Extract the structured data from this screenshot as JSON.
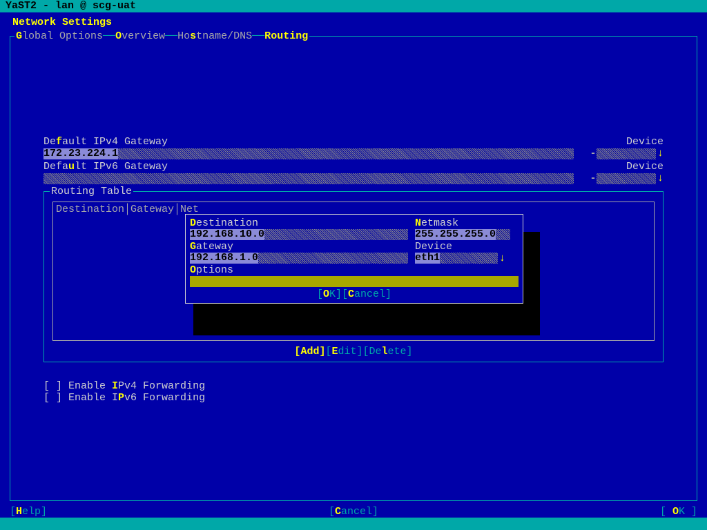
{
  "titlebar": "YaST2 - lan @ scg-uat",
  "page_title": "Network Settings",
  "tabs": {
    "pre1": "G",
    "label1": "lobal Options",
    "pre2": "O",
    "label2": "verview",
    "pre3": "Ho",
    "hot3": "s",
    "post3": "tname/DNS",
    "hot4": "R",
    "label4": "outing",
    "sep": "──"
  },
  "gateway": {
    "ipv4_pre": "De",
    "ipv4_hot": "f",
    "ipv4_post": "ault IPv4 Gateway",
    "ipv4_value": "172.23.224.1",
    "ipv6_pre": "Defa",
    "ipv6_hot": "u",
    "ipv6_post": "lt IPv6 Gateway",
    "device_label": "Device",
    "dash": "-",
    "arrow": "↓"
  },
  "routing": {
    "title": "Routing Table",
    "headers": "Destination│Gateway│Netmask│Device│Options",
    "add_lb": "[",
    "add_hot": "A",
    "add_post": "dd]",
    "edit_lb": "[",
    "edit_hot": "E",
    "edit_post": "dit]",
    "del_lb": "[De",
    "del_hot": "l",
    "del_post": "ete]"
  },
  "checks": {
    "c1_pre": "[ ] Enable ",
    "c1_hot": "I",
    "c1_post": "Pv4 Forwarding",
    "c2_pre": "[ ] Enable I",
    "c2_hot": "P",
    "c2_post": "v6 Forwarding"
  },
  "bottom": {
    "help_lb": "[",
    "help_hot": "H",
    "help_post": "elp]",
    "cancel_lb": "[",
    "cancel_hot": "C",
    "cancel_post": "ancel]",
    "ok_lb": "[ ",
    "ok_hot": "O",
    "ok_post": "K ]"
  },
  "modal": {
    "dest_pre": "",
    "dest_hot": "D",
    "dest_post": "estination",
    "dest_value": "192.168.10.0",
    "nm_pre": "",
    "nm_hot": "N",
    "nm_post": "etmask",
    "nm_value": "255.255.255.0",
    "gw_pre": "",
    "gw_hot": "G",
    "gw_post": "ateway",
    "gw_value": "192.168.1.0",
    "dev_label": "Device",
    "dev_value": "eth1",
    "opts_pre": "",
    "opts_hot": "O",
    "opts_post": "ptions",
    "ok_lb": "[",
    "ok_hot": "O",
    "ok_post": "K]",
    "cancel_lb": "[",
    "cancel_hot": "C",
    "cancel_post": "ancel]",
    "arrow": "↓"
  }
}
